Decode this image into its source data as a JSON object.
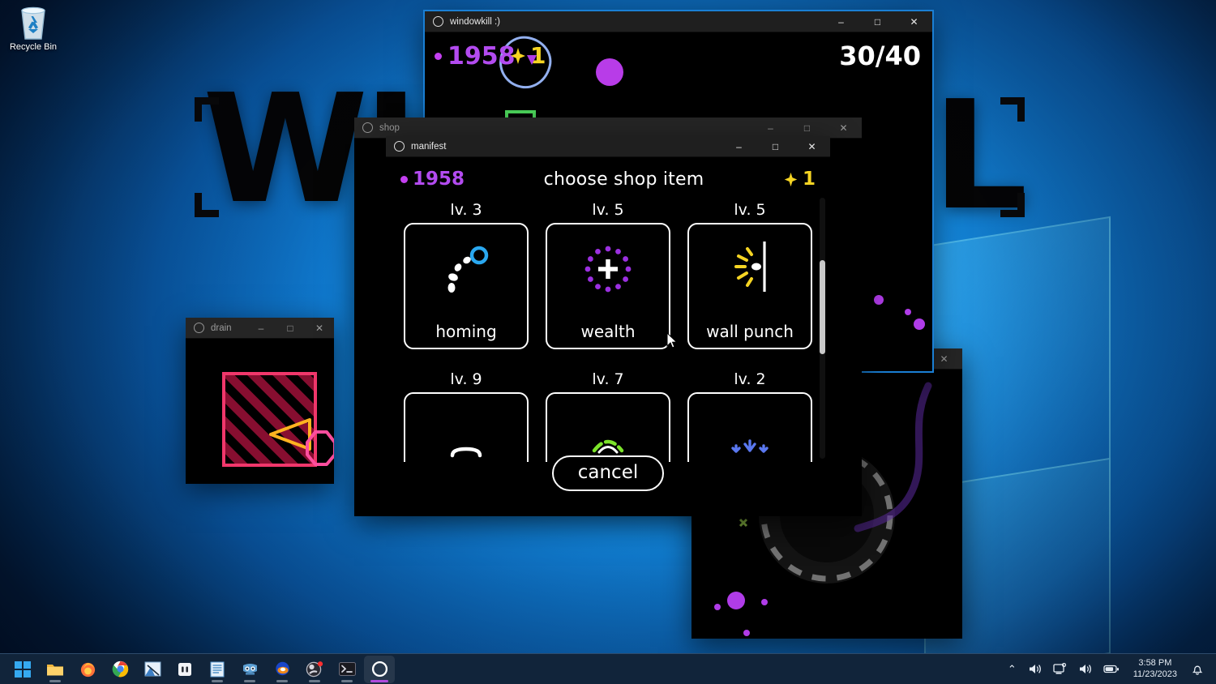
{
  "desktop": {
    "wallpaper_letters": [
      "WI",
      "L"
    ],
    "recycle_bin": {
      "label": "Recycle Bin",
      "icon": "recycle-bin-icon"
    },
    "accent_blue": "#1e9ff2"
  },
  "windows": {
    "windowkill": {
      "title": "windowkill :)",
      "icon": "circle-icon",
      "minimize": "–",
      "maximize": "□",
      "close": "✕",
      "hud": {
        "coin_count": "1958",
        "gem_count": "1",
        "health": "30/40"
      },
      "colors": {
        "coin": "#b34bf0",
        "gem": "#f5d423",
        "enemy": "#50e060",
        "ring": "#93b0ef"
      }
    },
    "drain": {
      "title": "drain",
      "icon": "circle-icon",
      "minimize": "–",
      "maximize": "□",
      "close": "✕",
      "colors": {
        "box": "#f0376b",
        "player": "#ffb320",
        "octagon": "#ff4fa0"
      }
    },
    "right_game": {
      "title": "",
      "minimize": "–",
      "maximize": "□",
      "close": "✕"
    },
    "shop": {
      "title": "shop",
      "icon": "circle-icon",
      "minimize": "–",
      "maximize": "□",
      "close": "✕"
    },
    "manifest": {
      "title": "manifest",
      "icon": "circle-icon",
      "minimize": "–",
      "maximize": "□",
      "close": "✕",
      "header": {
        "coin_count": "1958",
        "heading": "choose shop item",
        "gem_count": "1"
      },
      "items": [
        {
          "level": "lv. 3",
          "name": "homing",
          "icon": "homing-icon",
          "color": "#2aa8f0"
        },
        {
          "level": "lv. 5",
          "name": "wealth",
          "icon": "wealth-icon",
          "color": "#9b30e0"
        },
        {
          "level": "lv. 5",
          "name": "wall punch",
          "icon": "wall-punch-icon",
          "color": "#f5d423"
        },
        {
          "level": "lv. 9",
          "name": "",
          "icon": "shield-icon",
          "color": "#ffffff"
        },
        {
          "level": "lv. 7",
          "name": "",
          "icon": "dome-icon",
          "color": "#7ce32a"
        },
        {
          "level": "lv. 2",
          "name": "",
          "icon": "arrows-icon",
          "color": "#5a78f0"
        }
      ],
      "cancel_label": "cancel",
      "scrollbar": {
        "thumb_top_pct": 24,
        "thumb_height_pct": 36
      }
    }
  },
  "taskbar": {
    "apps": [
      {
        "name": "start-button",
        "icon": "windows-logo-icon",
        "active": false,
        "running": false
      },
      {
        "name": "file-explorer",
        "icon": "folder-icon",
        "active": false,
        "running": true
      },
      {
        "name": "firefox",
        "icon": "firefox-icon",
        "active": false,
        "running": false
      },
      {
        "name": "google-chrome",
        "icon": "chrome-icon",
        "active": false,
        "running": false
      },
      {
        "name": "snipping-tool",
        "icon": "snip-icon",
        "active": false,
        "running": false
      },
      {
        "name": "calculator",
        "icon": "app-icon",
        "active": false,
        "running": false
      },
      {
        "name": "notepad",
        "icon": "notepad-icon",
        "active": false,
        "running": true
      },
      {
        "name": "godot-engine",
        "icon": "godot-icon",
        "active": false,
        "running": true
      },
      {
        "name": "blender",
        "icon": "blender-icon",
        "active": false,
        "running": true
      },
      {
        "name": "obs-studio",
        "icon": "obs-icon",
        "active": false,
        "running": true
      },
      {
        "name": "terminal",
        "icon": "terminal-icon",
        "active": false,
        "running": true
      },
      {
        "name": "windowkill",
        "icon": "circle-icon",
        "active": true,
        "running": true
      }
    ],
    "tray": {
      "overflow": "⌃",
      "volume_1": "volume-icon",
      "network": "network-icon",
      "volume_2": "volume-icon",
      "battery": "battery-icon",
      "time": "3:58 PM",
      "date": "11/23/2023",
      "notifications": "bell-icon"
    }
  }
}
